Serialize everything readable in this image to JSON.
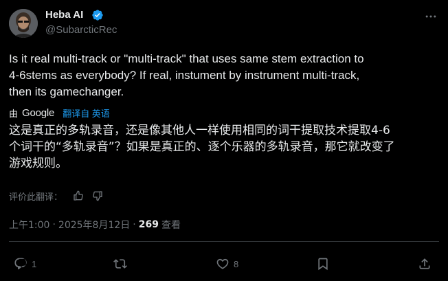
{
  "author": {
    "name": "Heba AI",
    "handle": "@SubarcticRec"
  },
  "tweet": {
    "text": "Is it real multi-track or \"multi-track\" that uses same stem extraction to\n4-6stems as everybody? If real, instument by instrument multi-track,\nthen its gamechanger."
  },
  "translation": {
    "by_label": "由",
    "provider": "Google",
    "translated_from": "翻译自 英语",
    "text": "这是真正的多轨录音，还是像其他人一样使用相同的词干提取技术提取4-6\n个词干的“多轨录音”？如果是真正的、逐个乐器的多轨录音，那它就改变了\n游戏规则。",
    "rate_label": "评价此翻译："
  },
  "meta": {
    "time": "上午1:00",
    "separator": "·",
    "date": "2025年8月12日",
    "views_count": "269",
    "views_label": "查看"
  },
  "actions": {
    "reply_count": "1",
    "retweet_count": "",
    "like_count": "8"
  },
  "colors": {
    "background": "#000000",
    "text": "#e7e9ea",
    "secondary": "#71767b",
    "link": "#1d9bf0",
    "verified": "#1d9bf0",
    "divider": "#2f3336"
  },
  "icons": {
    "verified": "verified-badge-icon",
    "more": "more-icon",
    "thumb_up": "thumb-up-icon",
    "thumb_down": "thumb-down-icon",
    "reply": "reply-icon",
    "retweet": "retweet-icon",
    "like": "heart-icon",
    "bookmark": "bookmark-icon",
    "share": "share-icon"
  }
}
